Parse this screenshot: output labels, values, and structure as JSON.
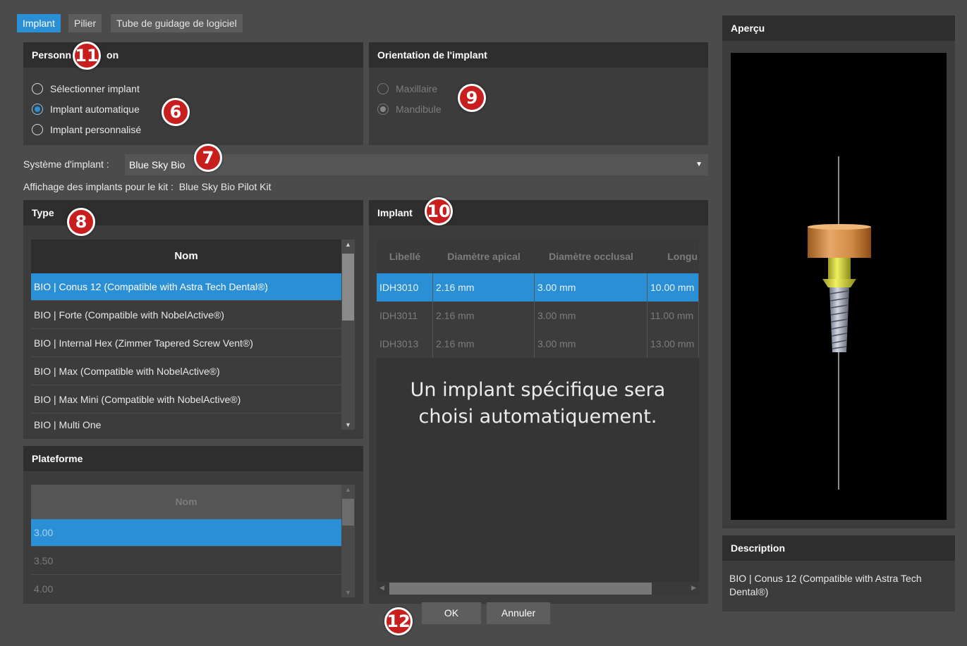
{
  "tabs": [
    "Implant",
    "Pilier",
    "Tube de guidage de logiciel"
  ],
  "personalisation": {
    "title_start": "Personn",
    "title_end": "on",
    "options": [
      "Sélectionner implant",
      "Implant automatique",
      "Implant personnalisé"
    ]
  },
  "orientation": {
    "title": "Orientation de l'implant",
    "options": [
      "Maxillaire",
      "Mandibule"
    ]
  },
  "system": {
    "label": "Système d'implant :",
    "value": "Blue Sky Bio"
  },
  "kit_text": "Affichage des implants pour le kit :  Blue Sky Bio Pilot Kit",
  "type_panel": {
    "title": "Type",
    "column": "Nom",
    "rows": [
      "BIO | Conus 12 (Compatible with Astra Tech Dental®)",
      "BIO | Forte (Compatible with NobelActive®)",
      "BIO | Internal Hex (Zimmer Tapered Screw Vent®)",
      "BIO | Max (Compatible with NobelActive®)",
      "BIO | Max Mini (Compatible with NobelActive®)",
      "BIO | Multi One"
    ]
  },
  "plateforme_panel": {
    "title": "Plateforme",
    "column": "Nom",
    "rows": [
      "3.00",
      "3.50",
      "4.00"
    ]
  },
  "implant_panel": {
    "title": "Implant",
    "columns": [
      "Libellé",
      "Diamètre apical",
      "Diamètre occlusal",
      "Longu"
    ],
    "rows": [
      [
        "IDH3010",
        "2.16 mm",
        "3.00 mm",
        "10.00 mm"
      ],
      [
        "IDH3011",
        "2.16 mm",
        "3.00 mm",
        "11.00 mm"
      ],
      [
        "IDH3013",
        "2.16 mm",
        "3.00 mm",
        "13.00 mm"
      ]
    ],
    "message_line1": "Un implant spécifique sera",
    "message_line2": "choisi automatiquement."
  },
  "preview": {
    "title": "Aperçu"
  },
  "description": {
    "title": "Description",
    "text": "BIO | Conus 12 (Compatible with Astra Tech Dental®)"
  },
  "buttons": {
    "ok": "OK",
    "cancel": "Annuler"
  },
  "markers": [
    "11",
    "6",
    "9",
    "7",
    "8",
    "10",
    "12"
  ],
  "colors": {
    "accent": "#2b8fd6",
    "marker": "#c81e1e"
  }
}
